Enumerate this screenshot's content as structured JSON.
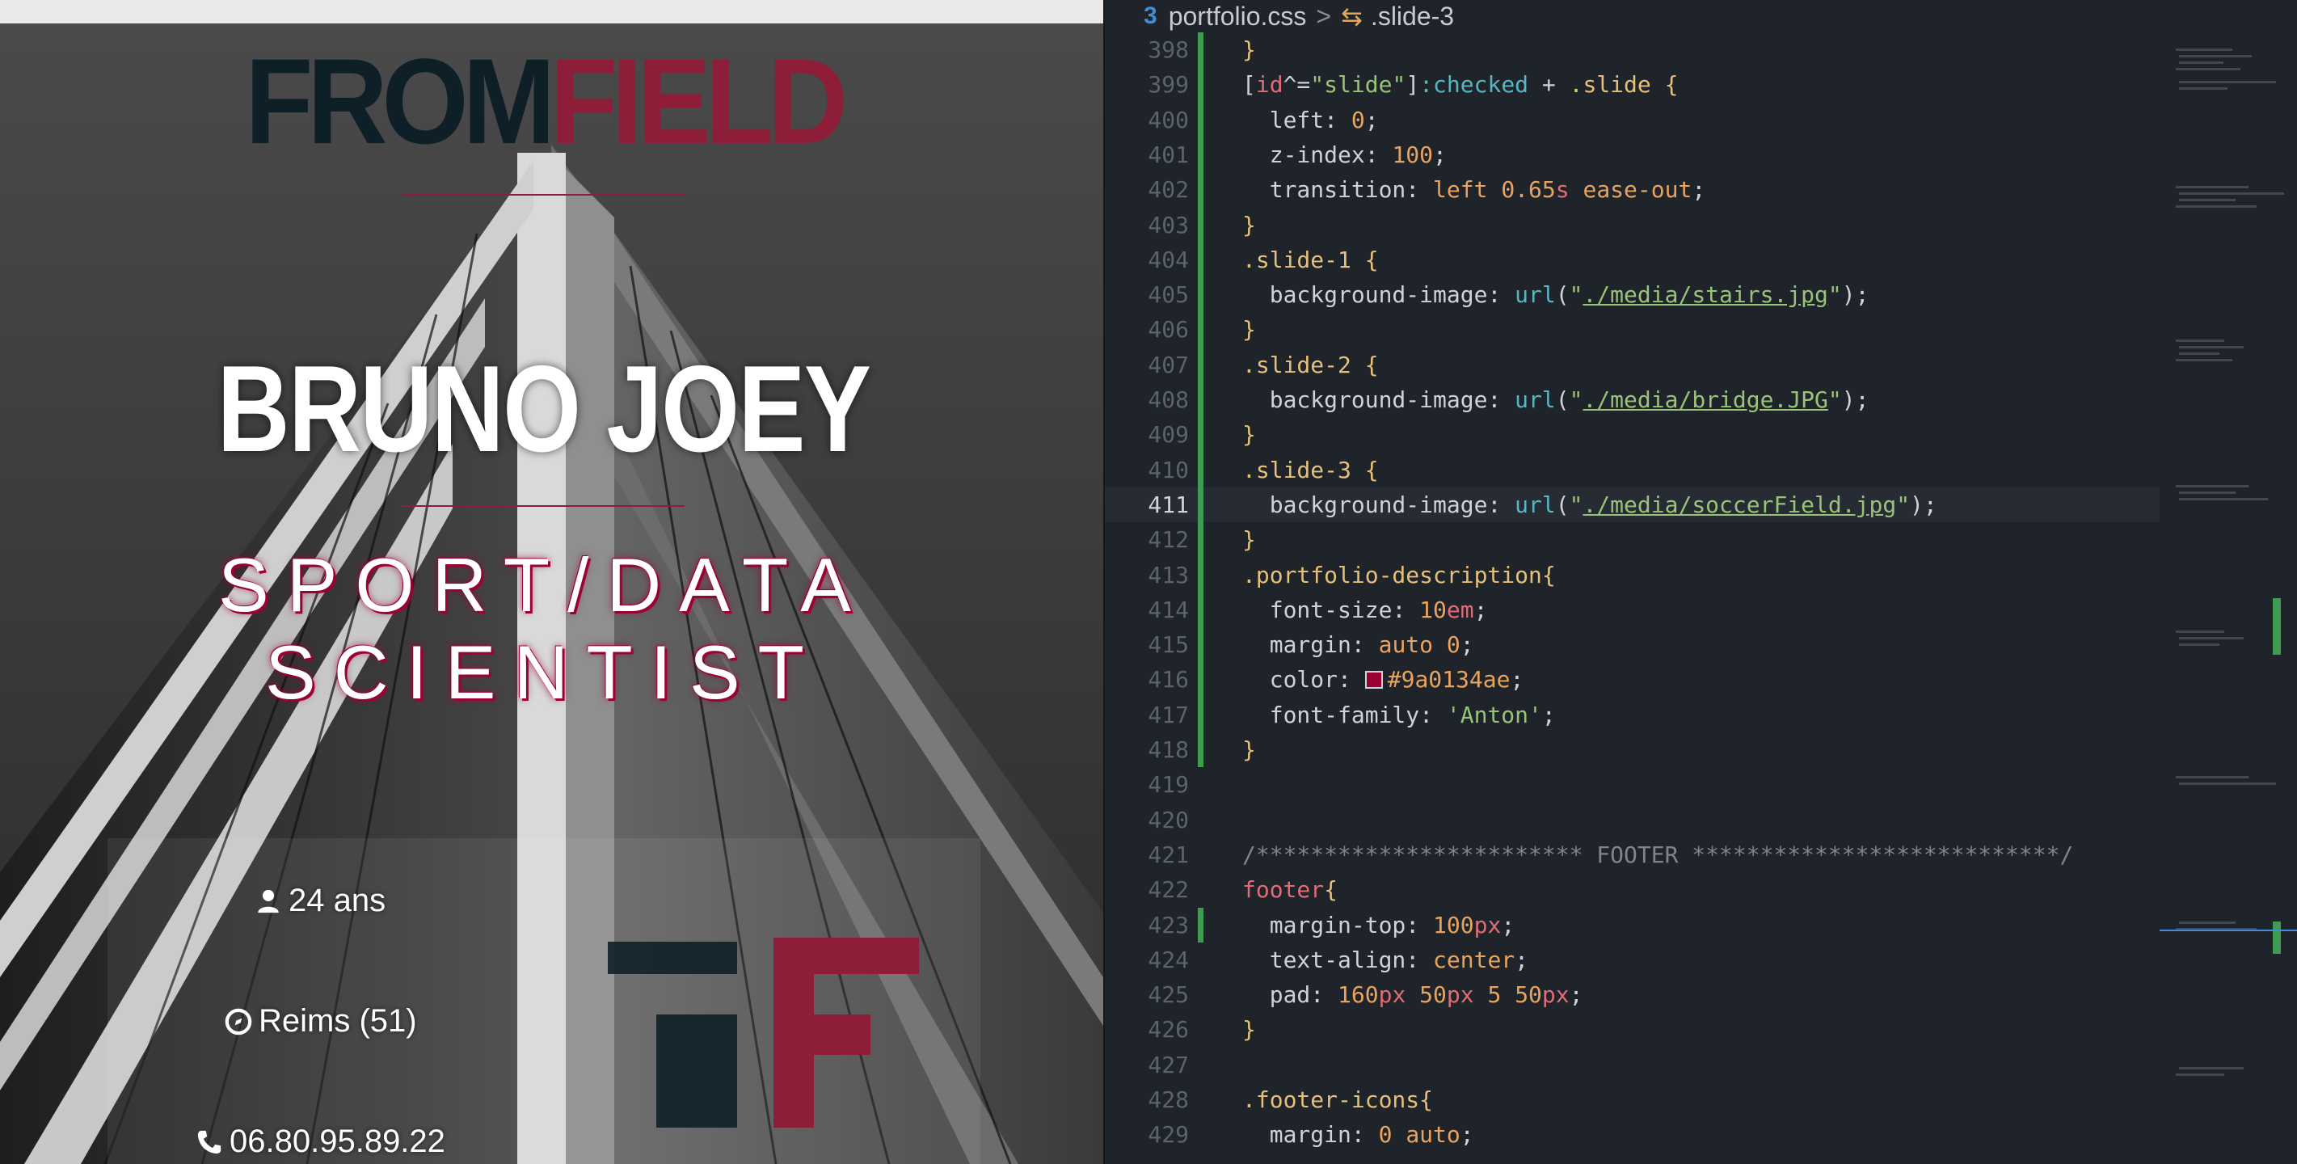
{
  "preview": {
    "brand_from": "FROM",
    "brand_field": "FIELD",
    "name": "BRUNO JOEY",
    "title_line1": "SPORT/DATA",
    "title_line2": "SCIENTIST",
    "info": {
      "age": "24 ans",
      "city": "Reims (51)",
      "phone": "06.80.95.89.22"
    },
    "colors": {
      "brand_dark": "#0f1f28",
      "brand_red": "#8e1d38",
      "accent": "#9a0134"
    }
  },
  "editor": {
    "breadcrumb": {
      "file": "portfolio.css",
      "symbol": ".slide-3"
    },
    "lines": [
      {
        "n": "398",
        "code": "}"
      },
      {
        "n": "399",
        "code": "[id^=\"slide\"]:checked + .slide {"
      },
      {
        "n": "400",
        "code": "  left: 0;"
      },
      {
        "n": "401",
        "code": "  z-index: 100;"
      },
      {
        "n": "402",
        "code": "  transition: left 0.65s ease-out;"
      },
      {
        "n": "403",
        "code": "}"
      },
      {
        "n": "404",
        "code": ".slide-1 {"
      },
      {
        "n": "405",
        "code": "  background-image: url(\"./media/stairs.jpg\");"
      },
      {
        "n": "406",
        "code": "}"
      },
      {
        "n": "407",
        "code": ".slide-2 {"
      },
      {
        "n": "408",
        "code": "  background-image: url(\"./media/bridge.JPG\");"
      },
      {
        "n": "409",
        "code": "}"
      },
      {
        "n": "410",
        "code": ".slide-3 {"
      },
      {
        "n": "411",
        "code": "  background-image: url(\"./media/soccerField.jpg\");"
      },
      {
        "n": "412",
        "code": "}"
      },
      {
        "n": "413",
        "code": ".portfolio-description{"
      },
      {
        "n": "414",
        "code": "  font-size: 10em;"
      },
      {
        "n": "415",
        "code": "  margin: auto 0;"
      },
      {
        "n": "416",
        "code": "  color: #9a0134ae;"
      },
      {
        "n": "417",
        "code": "  font-family: 'Anton';"
      },
      {
        "n": "418",
        "code": "}"
      },
      {
        "n": "419",
        "code": ""
      },
      {
        "n": "420",
        "code": ""
      },
      {
        "n": "421",
        "code": "/************************ FOOTER ***************************/"
      },
      {
        "n": "422",
        "code": "footer{"
      },
      {
        "n": "423",
        "code": "  margin-top: 100px;"
      },
      {
        "n": "424",
        "code": "  text-align: center;"
      },
      {
        "n": "425",
        "code": "  pad: 160px 50px 5 50px;"
      },
      {
        "n": "426",
        "code": "}"
      },
      {
        "n": "427",
        "code": ""
      },
      {
        "n": "428",
        "code": ".footer-icons{"
      },
      {
        "n": "429",
        "code": "  margin: 0 auto;"
      }
    ],
    "active_line": "411",
    "swatch_color": "#9a0134"
  }
}
